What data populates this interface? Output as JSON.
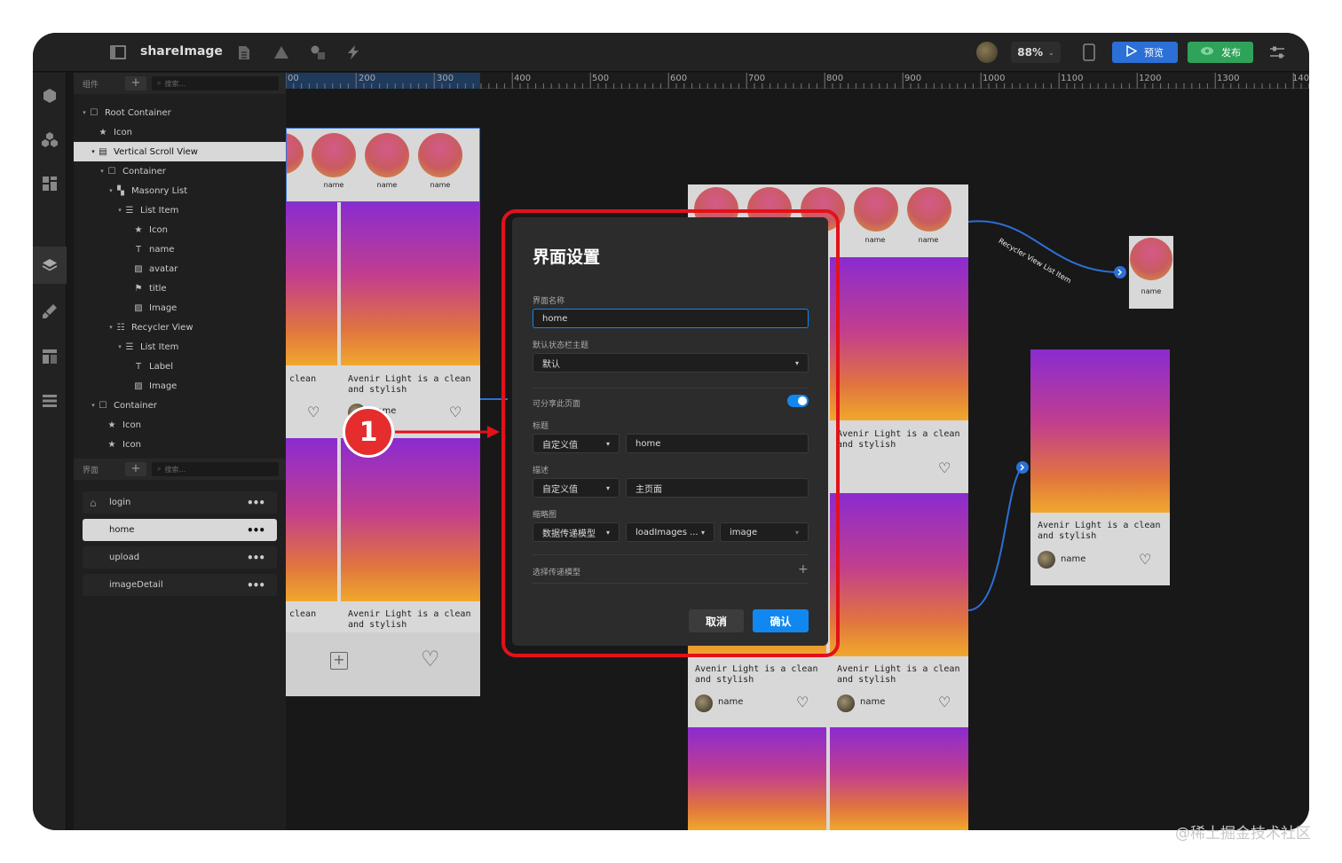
{
  "topbar": {
    "app_name": "shareImage",
    "zoom": "88%",
    "preview_label": "预览",
    "publish_label": "发布"
  },
  "component_panel": {
    "header_label": "组件",
    "search_placeholder": "搜索...",
    "tree": [
      {
        "label": "Root Container",
        "icon": "square-icon"
      },
      {
        "label": "Icon",
        "icon": "star-icon"
      },
      {
        "label": "Vertical Scroll View",
        "icon": "scroll-icon",
        "selected": true
      },
      {
        "label": "Container",
        "icon": "square-icon"
      },
      {
        "label": "Masonry List",
        "icon": "masonry-icon"
      },
      {
        "label": "List Item",
        "icon": "list-icon"
      },
      {
        "label": "Icon",
        "icon": "star-icon"
      },
      {
        "label": "name",
        "icon": "text-icon"
      },
      {
        "label": "avatar",
        "icon": "image-icon"
      },
      {
        "label": "title",
        "icon": "flag-icon"
      },
      {
        "label": "Image",
        "icon": "image-icon"
      },
      {
        "label": "Recycler View",
        "icon": "recycler-icon"
      },
      {
        "label": "List Item",
        "icon": "list-icon"
      },
      {
        "label": "Label",
        "icon": "text-icon"
      },
      {
        "label": "Image",
        "icon": "image-icon"
      },
      {
        "label": "Container",
        "icon": "square-icon"
      },
      {
        "label": "Icon",
        "icon": "star-icon"
      },
      {
        "label": "Icon",
        "icon": "star-icon"
      }
    ]
  },
  "pages_panel": {
    "header_label": "界面",
    "search_placeholder": "搜索...",
    "pages": [
      {
        "label": "login",
        "selected": false
      },
      {
        "label": "home",
        "selected": true
      },
      {
        "label": "upload",
        "selected": false
      },
      {
        "label": "imageDetail",
        "selected": false
      }
    ]
  },
  "ruler": {
    "ticks": [
      "00",
      "200",
      "300",
      "400",
      "500",
      "600",
      "700",
      "800",
      "900",
      "1000",
      "1100",
      "1200",
      "1300",
      "140"
    ]
  },
  "canvas": {
    "circle_label": "name",
    "card_title": "Avenir Light is a clean and stylish",
    "card_title_short": "clean",
    "card_name": "name",
    "connection_label": "Recycler View List Item"
  },
  "dialog": {
    "title": "界面设置",
    "page_name_label": "界面名称",
    "page_name_value": "home",
    "statusbar_label": "默认状态栏主题",
    "statusbar_value": "默认",
    "shareable_label": "可分享此页面",
    "shareable_on": true,
    "title_label": "标题",
    "title_mode": "自定义值",
    "title_value": "home",
    "desc_label": "描述",
    "desc_mode": "自定义值",
    "desc_value": "主页面",
    "thumb_label": "缩略图",
    "thumb_mode": "数据传递模型",
    "thumb_source": "loadImages ...",
    "thumb_field": "image",
    "model_label": "选择传递模型",
    "cancel_label": "取消",
    "ok_label": "确认"
  },
  "annotation": {
    "badge": "1"
  },
  "watermark": "@稀土掘金技术社区",
  "colors": {
    "accent": "#1088f0",
    "publish": "#2fa35a",
    "highlight": "#e3111a"
  }
}
